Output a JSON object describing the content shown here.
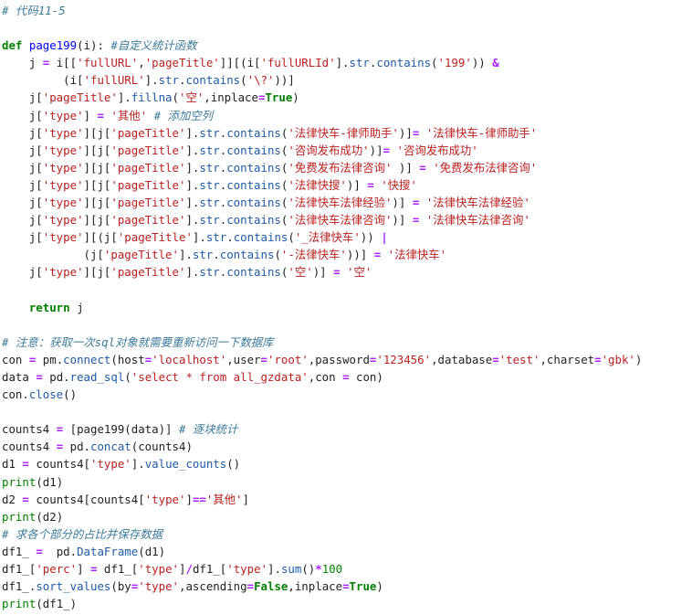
{
  "code_lines": [
    [
      [
        "cm",
        "# 代码11-5"
      ]
    ],
    [],
    [
      [
        "kw",
        "def"
      ],
      [
        "pl",
        " "
      ],
      [
        "fn",
        "page199"
      ],
      [
        "pl",
        "(i): "
      ],
      [
        "cm",
        "#自定义统计函数"
      ]
    ],
    [
      [
        "pl",
        "    j "
      ],
      [
        "op",
        "="
      ],
      [
        "pl",
        " i[["
      ],
      [
        "st",
        "'fullURL'"
      ],
      [
        "pl",
        ","
      ],
      [
        "st",
        "'pageTitle'"
      ],
      [
        "pl",
        "]][(i["
      ],
      [
        "st",
        "'fullURLId'"
      ],
      [
        "pl",
        "]."
      ],
      [
        "at",
        "str"
      ],
      [
        "pl",
        "."
      ],
      [
        "at",
        "contains"
      ],
      [
        "pl",
        "("
      ],
      [
        "st",
        "'199'"
      ],
      [
        "pl",
        ")) "
      ],
      [
        "op",
        "&"
      ]
    ],
    [
      [
        "pl",
        "         (i["
      ],
      [
        "st",
        "'fullURL'"
      ],
      [
        "pl",
        "]."
      ],
      [
        "at",
        "str"
      ],
      [
        "pl",
        "."
      ],
      [
        "at",
        "contains"
      ],
      [
        "pl",
        "("
      ],
      [
        "st",
        "'\\?'"
      ],
      [
        "pl",
        "))]"
      ]
    ],
    [
      [
        "pl",
        "    j["
      ],
      [
        "st",
        "'pageTitle'"
      ],
      [
        "pl",
        "]."
      ],
      [
        "at",
        "fillna"
      ],
      [
        "pl",
        "("
      ],
      [
        "st",
        "'空'"
      ],
      [
        "pl",
        ",inplace"
      ],
      [
        "op",
        "="
      ],
      [
        "kw",
        "True"
      ],
      [
        "pl",
        ")"
      ]
    ],
    [
      [
        "pl",
        "    j["
      ],
      [
        "st",
        "'type'"
      ],
      [
        "pl",
        "] "
      ],
      [
        "op",
        "="
      ],
      [
        "pl",
        " "
      ],
      [
        "st",
        "'其他'"
      ],
      [
        "pl",
        " "
      ],
      [
        "cm",
        "# 添加空列"
      ]
    ],
    [
      [
        "pl",
        "    j["
      ],
      [
        "st",
        "'type'"
      ],
      [
        "pl",
        "][j["
      ],
      [
        "st",
        "'pageTitle'"
      ],
      [
        "pl",
        "]."
      ],
      [
        "at",
        "str"
      ],
      [
        "pl",
        "."
      ],
      [
        "at",
        "contains"
      ],
      [
        "pl",
        "("
      ],
      [
        "st",
        "'法律快车-律师助手'"
      ],
      [
        "pl",
        ")]"
      ],
      [
        "op",
        "="
      ],
      [
        "pl",
        " "
      ],
      [
        "st",
        "'法律快车-律师助手'"
      ]
    ],
    [
      [
        "pl",
        "    j["
      ],
      [
        "st",
        "'type'"
      ],
      [
        "pl",
        "][j["
      ],
      [
        "st",
        "'pageTitle'"
      ],
      [
        "pl",
        "]."
      ],
      [
        "at",
        "str"
      ],
      [
        "pl",
        "."
      ],
      [
        "at",
        "contains"
      ],
      [
        "pl",
        "("
      ],
      [
        "st",
        "'咨询发布成功'"
      ],
      [
        "pl",
        ")]"
      ],
      [
        "op",
        "="
      ],
      [
        "pl",
        " "
      ],
      [
        "st",
        "'咨询发布成功'"
      ]
    ],
    [
      [
        "pl",
        "    j["
      ],
      [
        "st",
        "'type'"
      ],
      [
        "pl",
        "][j["
      ],
      [
        "st",
        "'pageTitle'"
      ],
      [
        "pl",
        "]."
      ],
      [
        "at",
        "str"
      ],
      [
        "pl",
        "."
      ],
      [
        "at",
        "contains"
      ],
      [
        "pl",
        "("
      ],
      [
        "st",
        "'免费发布法律咨询'"
      ],
      [
        "pl",
        " )] "
      ],
      [
        "op",
        "="
      ],
      [
        "pl",
        " "
      ],
      [
        "st",
        "'免费发布法律咨询'"
      ]
    ],
    [
      [
        "pl",
        "    j["
      ],
      [
        "st",
        "'type'"
      ],
      [
        "pl",
        "][j["
      ],
      [
        "st",
        "'pageTitle'"
      ],
      [
        "pl",
        "]."
      ],
      [
        "at",
        "str"
      ],
      [
        "pl",
        "."
      ],
      [
        "at",
        "contains"
      ],
      [
        "pl",
        "("
      ],
      [
        "st",
        "'法律快搜'"
      ],
      [
        "pl",
        ")] "
      ],
      [
        "op",
        "="
      ],
      [
        "pl",
        " "
      ],
      [
        "st",
        "'快搜'"
      ]
    ],
    [
      [
        "pl",
        "    j["
      ],
      [
        "st",
        "'type'"
      ],
      [
        "pl",
        "][j["
      ],
      [
        "st",
        "'pageTitle'"
      ],
      [
        "pl",
        "]."
      ],
      [
        "at",
        "str"
      ],
      [
        "pl",
        "."
      ],
      [
        "at",
        "contains"
      ],
      [
        "pl",
        "("
      ],
      [
        "st",
        "'法律快车法律经验'"
      ],
      [
        "pl",
        ")] "
      ],
      [
        "op",
        "="
      ],
      [
        "pl",
        " "
      ],
      [
        "st",
        "'法律快车法律经验'"
      ]
    ],
    [
      [
        "pl",
        "    j["
      ],
      [
        "st",
        "'type'"
      ],
      [
        "pl",
        "][j["
      ],
      [
        "st",
        "'pageTitle'"
      ],
      [
        "pl",
        "]."
      ],
      [
        "at",
        "str"
      ],
      [
        "pl",
        "."
      ],
      [
        "at",
        "contains"
      ],
      [
        "pl",
        "("
      ],
      [
        "st",
        "'法律快车法律咨询'"
      ],
      [
        "pl",
        ")] "
      ],
      [
        "op",
        "="
      ],
      [
        "pl",
        " "
      ],
      [
        "st",
        "'法律快车法律咨询'"
      ]
    ],
    [
      [
        "pl",
        "    j["
      ],
      [
        "st",
        "'type'"
      ],
      [
        "pl",
        "][(j["
      ],
      [
        "st",
        "'pageTitle'"
      ],
      [
        "pl",
        "]."
      ],
      [
        "at",
        "str"
      ],
      [
        "pl",
        "."
      ],
      [
        "at",
        "contains"
      ],
      [
        "pl",
        "("
      ],
      [
        "st",
        "'_法律快车'"
      ],
      [
        "pl",
        ")) "
      ],
      [
        "op",
        "|"
      ]
    ],
    [
      [
        "pl",
        "            (j["
      ],
      [
        "st",
        "'pageTitle'"
      ],
      [
        "pl",
        "]."
      ],
      [
        "at",
        "str"
      ],
      [
        "pl",
        "."
      ],
      [
        "at",
        "contains"
      ],
      [
        "pl",
        "("
      ],
      [
        "st",
        "'-法律快车'"
      ],
      [
        "pl",
        "))] "
      ],
      [
        "op",
        "="
      ],
      [
        "pl",
        " "
      ],
      [
        "st",
        "'法律快车'"
      ]
    ],
    [
      [
        "pl",
        "    j["
      ],
      [
        "st",
        "'type'"
      ],
      [
        "pl",
        "][j["
      ],
      [
        "st",
        "'pageTitle'"
      ],
      [
        "pl",
        "]."
      ],
      [
        "at",
        "str"
      ],
      [
        "pl",
        "."
      ],
      [
        "at",
        "contains"
      ],
      [
        "pl",
        "("
      ],
      [
        "st",
        "'空'"
      ],
      [
        "pl",
        ")] "
      ],
      [
        "op",
        "="
      ],
      [
        "pl",
        " "
      ],
      [
        "st",
        "'空'"
      ]
    ],
    [],
    [
      [
        "pl",
        "    "
      ],
      [
        "kw",
        "return"
      ],
      [
        "pl",
        " j"
      ]
    ],
    [],
    [
      [
        "cm",
        "# 注意：获取一次sql对象就需要重新访问一下数据库"
      ]
    ],
    [
      [
        "pl",
        "con "
      ],
      [
        "op",
        "="
      ],
      [
        "pl",
        " pm."
      ],
      [
        "at",
        "connect"
      ],
      [
        "pl",
        "(host"
      ],
      [
        "op",
        "="
      ],
      [
        "st",
        "'localhost'"
      ],
      [
        "pl",
        ",user"
      ],
      [
        "op",
        "="
      ],
      [
        "st",
        "'root'"
      ],
      [
        "pl",
        ",password"
      ],
      [
        "op",
        "="
      ],
      [
        "st",
        "'123456'"
      ],
      [
        "pl",
        ",database"
      ],
      [
        "op",
        "="
      ],
      [
        "st",
        "'test'"
      ],
      [
        "pl",
        ",charset"
      ],
      [
        "op",
        "="
      ],
      [
        "st",
        "'gbk'"
      ],
      [
        "pl",
        ")"
      ]
    ],
    [
      [
        "pl",
        "data "
      ],
      [
        "op",
        "="
      ],
      [
        "pl",
        " pd."
      ],
      [
        "at",
        "read_sql"
      ],
      [
        "pl",
        "("
      ],
      [
        "st",
        "'select * from all_gzdata'"
      ],
      [
        "pl",
        ",con "
      ],
      [
        "op",
        "="
      ],
      [
        "pl",
        " con)"
      ]
    ],
    [
      [
        "pl",
        "con."
      ],
      [
        "at",
        "close"
      ],
      [
        "pl",
        "()"
      ]
    ],
    [],
    [
      [
        "pl",
        "counts4 "
      ],
      [
        "op",
        "="
      ],
      [
        "pl",
        " [page199(data)] "
      ],
      [
        "cm",
        "# 逐块统计"
      ]
    ],
    [
      [
        "pl",
        "counts4 "
      ],
      [
        "op",
        "="
      ],
      [
        "pl",
        " pd."
      ],
      [
        "at",
        "concat"
      ],
      [
        "pl",
        "(counts4)"
      ]
    ],
    [
      [
        "pl",
        "d1 "
      ],
      [
        "op",
        "="
      ],
      [
        "pl",
        " counts4["
      ],
      [
        "st",
        "'type'"
      ],
      [
        "pl",
        "]."
      ],
      [
        "at",
        "value_counts"
      ],
      [
        "pl",
        "()"
      ]
    ],
    [
      [
        "nb",
        "print"
      ],
      [
        "pl",
        "(d1)"
      ]
    ],
    [
      [
        "pl",
        "d2 "
      ],
      [
        "op",
        "="
      ],
      [
        "pl",
        " counts4[counts4["
      ],
      [
        "st",
        "'type'"
      ],
      [
        "pl",
        "]"
      ],
      [
        "op",
        "=="
      ],
      [
        "st",
        "'其他'"
      ],
      [
        "pl",
        "]"
      ]
    ],
    [
      [
        "nb",
        "print"
      ],
      [
        "pl",
        "(d2)"
      ]
    ],
    [
      [
        "cm",
        "# 求各个部分的占比并保存数据"
      ]
    ],
    [
      [
        "pl",
        "df1_ "
      ],
      [
        "op",
        "="
      ],
      [
        "pl",
        "  pd."
      ],
      [
        "at",
        "DataFrame"
      ],
      [
        "pl",
        "(d1)"
      ]
    ],
    [
      [
        "pl",
        "df1_["
      ],
      [
        "st",
        "'perc'"
      ],
      [
        "pl",
        "] "
      ],
      [
        "op",
        "="
      ],
      [
        "pl",
        " df1_["
      ],
      [
        "st",
        "'type'"
      ],
      [
        "pl",
        "]"
      ],
      [
        "op",
        "/"
      ],
      [
        "pl",
        "df1_["
      ],
      [
        "st",
        "'type'"
      ],
      [
        "pl",
        "]."
      ],
      [
        "at",
        "sum"
      ],
      [
        "pl",
        "()"
      ],
      [
        "op",
        "*"
      ],
      [
        "nu",
        "100"
      ]
    ],
    [
      [
        "pl",
        "df1_."
      ],
      [
        "at",
        "sort_values"
      ],
      [
        "pl",
        "(by"
      ],
      [
        "op",
        "="
      ],
      [
        "st",
        "'type'"
      ],
      [
        "pl",
        ",ascending"
      ],
      [
        "op",
        "="
      ],
      [
        "kw",
        "False"
      ],
      [
        "pl",
        ",inplace"
      ],
      [
        "op",
        "="
      ],
      [
        "kw",
        "True"
      ],
      [
        "pl",
        ")"
      ]
    ],
    [
      [
        "nb",
        "print"
      ],
      [
        "pl",
        "(df1_)"
      ]
    ]
  ]
}
